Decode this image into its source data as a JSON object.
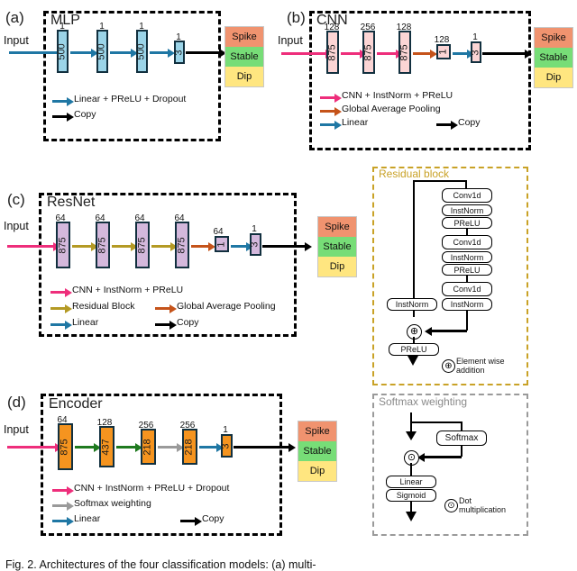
{
  "figure": {
    "caption": "Fig. 2.   Architectures of the four classification models: (a) multi-"
  },
  "output_classes": {
    "spike": "Spike",
    "stable": "Stable",
    "dip": "Dip",
    "colors": {
      "spike": "#F0936F",
      "stable": "#77DD77",
      "dip": "#FFE680"
    }
  },
  "input_label": "Input",
  "panels": [
    {
      "tag": "(a)",
      "title": "MLP",
      "block_color": "#9BD4E8",
      "arrow_color": "#1F77A4",
      "blocks": [
        {
          "top": "1",
          "inner": "500"
        },
        {
          "top": "1",
          "inner": "500"
        },
        {
          "top": "1",
          "inner": "500"
        },
        {
          "top": "1",
          "inner": "3"
        }
      ],
      "legend": [
        {
          "label": "Linear + PReLU + Dropout",
          "color": "#1F77A4"
        },
        {
          "label": "Copy",
          "color": "#000000"
        }
      ]
    },
    {
      "tag": "(b)",
      "title": "CNN",
      "block_color": "#FBD5D5",
      "arrow_color": "#EE2E7B",
      "blocks": [
        {
          "top": "128",
          "inner": "875"
        },
        {
          "top": "256",
          "inner": "875"
        },
        {
          "top": "128",
          "inner": "875"
        },
        {
          "top": "128",
          "inner": "1"
        },
        {
          "top": "1",
          "inner": "3"
        }
      ],
      "legend": [
        {
          "label": "CNN + InstNorm + PReLU",
          "color": "#EE2E7B"
        },
        {
          "label": "Global Average Pooling",
          "color": "#C5531A"
        },
        {
          "label": "Linear",
          "color": "#1F77A4"
        },
        {
          "label": "Copy",
          "color": "#000000"
        }
      ]
    },
    {
      "tag": "(c)",
      "title": "ResNet",
      "block_color": "#D4B8DC",
      "arrow_color": "#B49A24",
      "blocks": [
        {
          "top": "64",
          "inner": "875"
        },
        {
          "top": "64",
          "inner": "875"
        },
        {
          "top": "64",
          "inner": "875"
        },
        {
          "top": "64",
          "inner": "875"
        },
        {
          "top": "64",
          "inner": "1"
        },
        {
          "top": "1",
          "inner": "3"
        }
      ],
      "legend": [
        {
          "label": "CNN + InstNorm + PReLU",
          "color": "#EE2E7B"
        },
        {
          "label": "Residual Block",
          "color": "#B49A24"
        },
        {
          "label": "Global Average Pooling",
          "color": "#C5531A"
        },
        {
          "label": "Linear",
          "color": "#1F77A4"
        },
        {
          "label": "Copy",
          "color": "#000000"
        }
      ]
    },
    {
      "tag": "(d)",
      "title": "Encoder",
      "block_color": "#F5941F",
      "arrow_color": "#1F7A1F",
      "blocks": [
        {
          "top": "64",
          "inner": "875"
        },
        {
          "top": "128",
          "inner": "437"
        },
        {
          "top": "256",
          "inner": "218"
        },
        {
          "top": "256",
          "inner": "218"
        },
        {
          "top": "1",
          "inner": "3"
        }
      ],
      "legend": [
        {
          "label": "CNN + InstNorm + PReLU + Dropout",
          "color": "#EE2E7B"
        },
        {
          "label": "Softmax weighting",
          "color": "#9A9A9A"
        },
        {
          "label": "Linear",
          "color": "#1F77A4"
        },
        {
          "label": "Copy",
          "color": "#000000"
        }
      ]
    }
  ],
  "residual_block": {
    "title": "Residual block",
    "border_color": "#C9A227",
    "ops": [
      "Conv1d",
      "InstNorm",
      "PReLU",
      "Conv1d",
      "InstNorm",
      "PReLU",
      "Conv1d",
      "InstNorm"
    ],
    "shortcut_op": "InstNorm",
    "output_op": "PReLU",
    "add_symbol": "⊕",
    "add_legend": "Element wise\naddition",
    "add_legend_line1": "Element wise",
    "add_legend_line2": "addition"
  },
  "softmax_weighting": {
    "title": "Softmax weighting",
    "border_color": "#9A9A9A",
    "softmax_op": "Softmax",
    "linear_op": "Linear",
    "sigmoid_op": "Sigmoid",
    "dot_symbol": "⊙",
    "dot_legend_line1": "Dot",
    "dot_legend_line2": "multiplication"
  }
}
